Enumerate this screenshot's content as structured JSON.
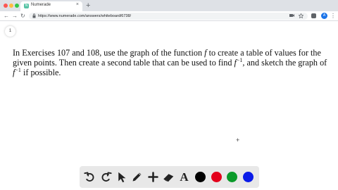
{
  "browser": {
    "tab_title": "Numerade",
    "tab_favicon": "N",
    "tab_close": "×",
    "new_tab": "+",
    "back": "←",
    "forward": "→",
    "reload": "↻",
    "url": "https://www.numerade.com/answers/whiteboard/6738/",
    "profile_initial": "A",
    "menu": "⋮",
    "lights": {
      "red": "#fc5753",
      "yellow": "#fdbc40",
      "green": "#33c748"
    },
    "icons": [
      "lock-icon",
      "camera-icon",
      "star-icon",
      "extension-icon",
      "extension-icon",
      "profile-avatar",
      "menu-icon"
    ]
  },
  "page": {
    "page_number": "1",
    "question": {
      "line1_a": "In Exercises 107 and 108, use the graph of the function ",
      "line1_f": "f",
      "line1_b": " to create a table of values for the",
      "line2_a": "given points. Then create a second table that can be used to find ",
      "line2_f": "f",
      "line2_sup": "−1",
      "line2_b": ", and sketch the graph of",
      "line3_f": "f",
      "line3_sup": "−1",
      "line3_b": " if possible."
    },
    "cursor": "+"
  },
  "whiteboard_toolbar": {
    "tools": [
      "undo-icon",
      "redo-icon",
      "pointer-icon",
      "pen-icon",
      "add-icon",
      "eraser-icon",
      "text-tool-icon"
    ],
    "text_tool_label": "A",
    "colors": [
      "#000000",
      "#e3001b",
      "#0b9a2a",
      "#0a1be8"
    ]
  }
}
